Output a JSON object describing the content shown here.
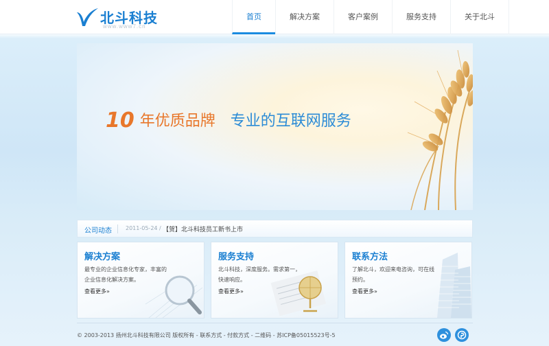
{
  "brand": {
    "name": "北斗科技",
    "url": "www.www7.cn"
  },
  "nav": {
    "items": [
      "首页",
      "解决方案",
      "客户案例",
      "服务支持",
      "关于北斗"
    ],
    "active_index": 0
  },
  "banner": {
    "number": "10",
    "brand_line": "年优质品牌",
    "service_line": "专业的互联网服务"
  },
  "news": {
    "title": "公司动态",
    "date": "2011-05-24 /",
    "headline": "【贺】北斗科技员工新书上市"
  },
  "cards": [
    {
      "title": "解决方案",
      "desc": "最专业的企业信息化专家，丰富的企业信息化解决方案。",
      "more": "查看更多»",
      "icon": "magnifier-paper-icon"
    },
    {
      "title": "服务支持",
      "desc": "北斗科技，深度服务。需求第一，快速响应。",
      "more": "查看更多»",
      "icon": "globe-newspaper-icon"
    },
    {
      "title": "联系方法",
      "desc": "了解北斗，欢迎来电咨询，可在线预约。",
      "more": "查看更多»",
      "icon": "building-icon"
    }
  ],
  "footer": {
    "copyright": "© 2003-2013 扬州北斗科技有限公司 版权所有 - 联系方式 - 付款方式 - 二维码 - 苏ICP备05015523号-5",
    "social": [
      "weibo-icon",
      "share-icon"
    ]
  },
  "colors": {
    "accent": "#1a7fd1",
    "highlight": "#e8772b"
  }
}
